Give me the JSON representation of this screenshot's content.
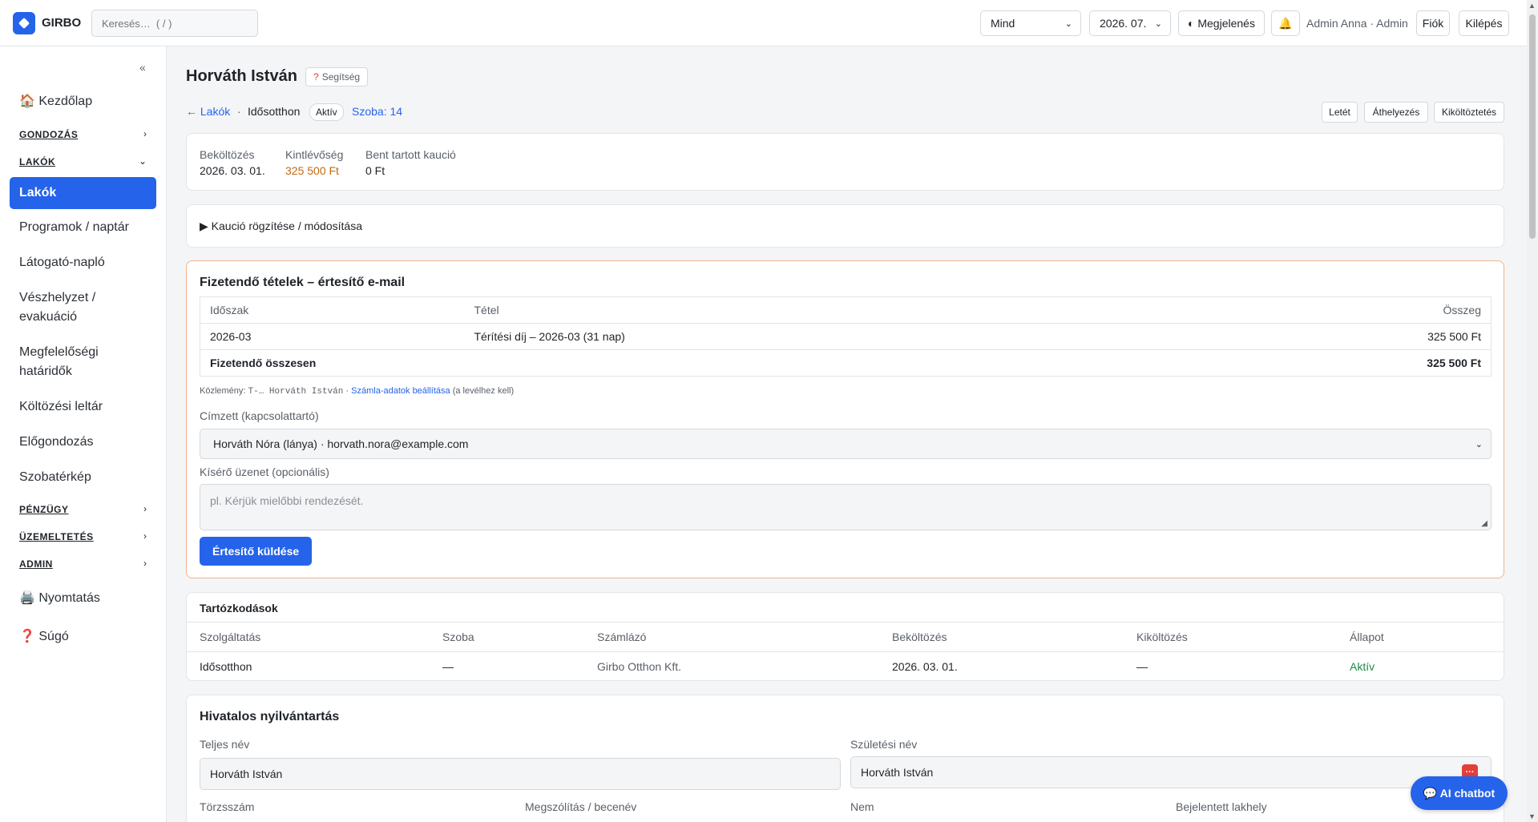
{
  "topbar": {
    "brand": "GIRBO",
    "search_placeholder": "Keresés…  ( / )",
    "filter_select": "Mind",
    "date_select": "2026. 07.",
    "appearance_label": "◐ Megjelenés",
    "bell_icon": "🔔",
    "user": "Admin Anna · Admin",
    "account_label": "Fiók",
    "logout_label": "Kilépés"
  },
  "sidebar": {
    "collapse": "«",
    "home": "🏠 Kezdőlap",
    "sections": {
      "care": "GONDOZÁS",
      "residents": "LAKÓK",
      "finance": "PÉNZÜGY",
      "operations": "ÜZEMELTETÉS",
      "admin": "ADMIN"
    },
    "items": {
      "residents": "Lakók",
      "programs": "Programok / naptár",
      "visitors": "Látogató-napló",
      "emergency": "Vészhelyzet / evakuáció",
      "compliance": "Megfelelőségi határidők",
      "moving_inventory": "Költözési leltár",
      "pre_care": "Előgondozás",
      "room_map": "Szobatérkép"
    },
    "print": "🖨️ Nyomtatás",
    "help": "❓ Súgó"
  },
  "page": {
    "title": "Horváth István",
    "help_label": "Segítség",
    "breadcrumb": {
      "back": "← Lakók",
      "sep": "·",
      "service": "Idősotthon",
      "status": "Aktív",
      "room": "Szoba: 14"
    },
    "actions": {
      "deposit": "Letét",
      "transfer": "Áthelyezés",
      "move_out": "Kiköltöztetés"
    },
    "stats": {
      "movein_label": "Beköltözés",
      "movein_value": "2026. 03. 01.",
      "outstanding_label": "Kintlévőség",
      "outstanding_value": "325 500 Ft",
      "deposit_label": "Bent tartott kaució",
      "deposit_value": "0 Ft"
    },
    "deposit_expander": "▶  Kaució rögzítése / módosítása"
  },
  "payables": {
    "title": "Fizetendő tételek – értesítő e-mail",
    "headers": [
      "Időszak",
      "Tétel",
      "Összeg"
    ],
    "rows": [
      {
        "period": "2026-03",
        "item": "Térítési díj – 2026-03 (31 nap)",
        "amount": "325 500 Ft"
      }
    ],
    "total_label": "Fizetendő összesen",
    "total_value": "325 500 Ft",
    "note_prefix": "Közlemény: ",
    "note_code": "T-… Horváth István",
    "note_sep": " · ",
    "note_link": "Számla-adatok beállítása",
    "note_suffix": " (a levélhez kell)",
    "recipient_label": "Címzett (kapcsolattartó)",
    "recipient_value": "Horváth Nóra (lánya) · horvath.nora@example.com",
    "message_label": "Kísérő üzenet (opcionális)",
    "message_placeholder": "pl. Kérjük mielőbbi rendezését.",
    "send_label": "Értesítő küldése"
  },
  "stays": {
    "title": "Tartózkodások",
    "headers": [
      "Szolgáltatás",
      "Szoba",
      "Számlázó",
      "Beköltözés",
      "Kiköltözés",
      "Állapot"
    ],
    "rows": [
      {
        "service": "Idősotthon",
        "room": "—",
        "biller": "Girbo Otthon Kft.",
        "move_in": "2026. 03. 01.",
        "move_out": "—",
        "status": "Aktív"
      }
    ]
  },
  "registry": {
    "title": "Hivatalos nyilvántartás",
    "full_name_label": "Teljes név",
    "full_name_value": "Horváth István",
    "birth_name_label": "Születési név",
    "birth_name_value": "Horváth István",
    "reg_no_label": "Törzsszám",
    "nickname_label": "Megszólítás / becenév",
    "gender_label": "Nem",
    "address_label": "Bejelentett lakhely"
  },
  "chatbot": "💬 AI chatbot",
  "colors": {
    "accent": "#2563eb",
    "warning": "#c26a12",
    "success": "#1e8a4a",
    "alert_border": "#f0b48a"
  }
}
